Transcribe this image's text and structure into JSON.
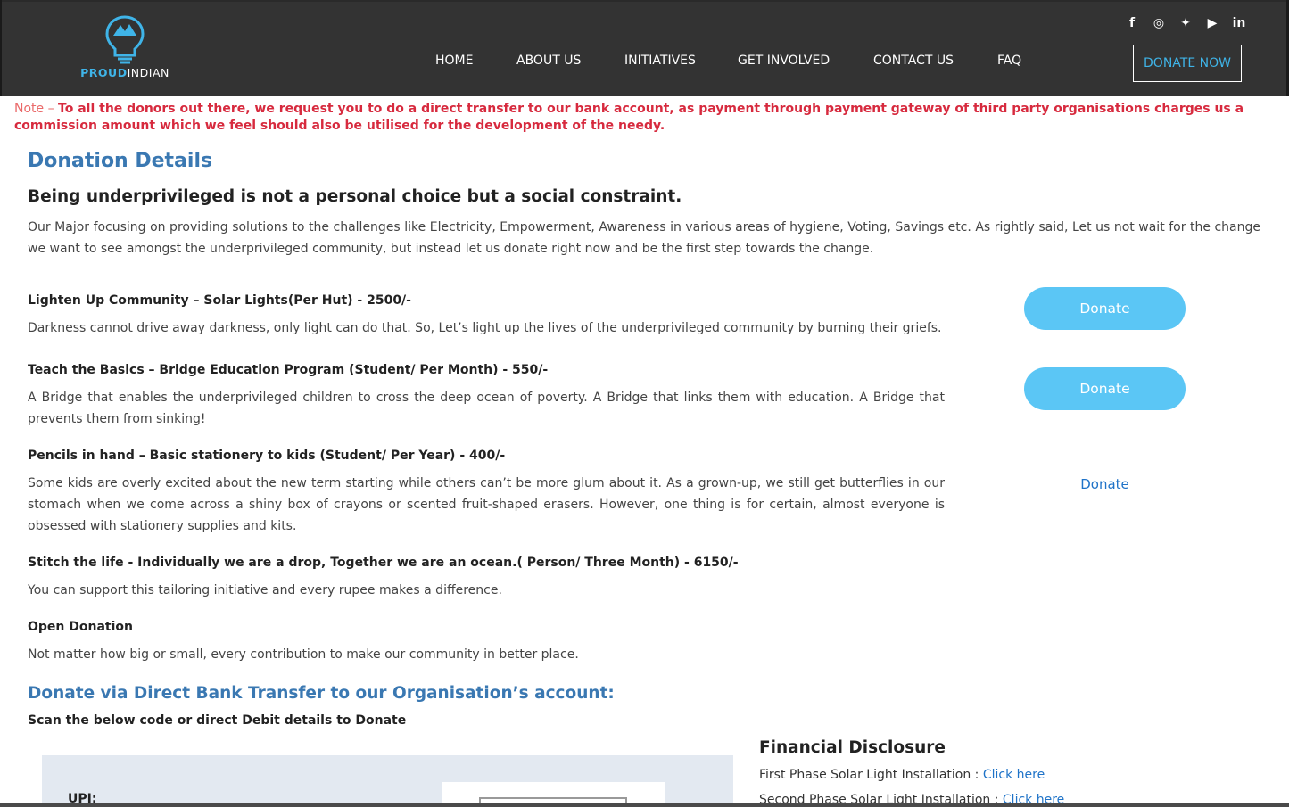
{
  "brand": {
    "name_part1": "PROUD",
    "name_part2": "INDIAN"
  },
  "social": [
    {
      "icon": "facebook-icon",
      "glyph": "f"
    },
    {
      "icon": "instagram-icon",
      "glyph": "◎"
    },
    {
      "icon": "twitter-icon",
      "glyph": "✦"
    },
    {
      "icon": "youtube-icon",
      "glyph": "▶"
    },
    {
      "icon": "linkedin-icon",
      "glyph": "in"
    }
  ],
  "nav": {
    "home": "HOME",
    "about": "ABOUT US",
    "initiatives": "INITIATIVES",
    "get_involved": "GET INVOLVED",
    "contact": "CONTACT US",
    "faq": "FAQ",
    "donate_now": "DONATE NOW"
  },
  "note": {
    "label": "Note – ",
    "text": "To all the donors out there, we request you to do a direct transfer to our bank account, as payment through payment gateway of third party organisations charges us a commission amount which we feel should also be utilised for the development of the needy."
  },
  "donation": {
    "heading": "Donation Details",
    "tagline": "Being underprivileged is not a personal choice but a social constraint.",
    "intro": "Our Major focusing on providing solutions to the challenges like Electricity, Empowerment, Awareness in various areas of hygiene, Voting, Savings etc. As rightly said, Let us not wait for the change we want to see amongst the underprivileged community, but instead let us donate right now and be the first step towards the change.",
    "items": [
      {
        "title": "Lighten Up Community – Solar Lights(Per Hut) - 2500/-",
        "desc": "Darkness cannot drive away darkness, only light can do that. So, Let’s light up the lives of the underprivileged community by burning their griefs.",
        "action": "Donate"
      },
      {
        "title": "Teach the Basics – Bridge Education Program (Student/ Per Month) - 550/-",
        "desc": "A Bridge that enables the underprivileged children to cross the deep ocean of poverty. A Bridge that links them with education. A Bridge that prevents them from sinking!",
        "action": "Donate"
      },
      {
        "title": "Pencils in hand – Basic stationery to kids (Student/ Per Year) - 400/-",
        "desc": "Some kids are overly excited about the new term starting while others can’t be more glum about it. As a grown-up, we still get butterflies in our stomach when we come across a shiny box of crayons or scented fruit-shaped erasers. However, one thing is for certain, almost everyone is obsessed with stationery supplies and kits.",
        "action": "Donate"
      },
      {
        "title": "Stitch the life - Individually we are a drop, Together we are an ocean.( Person/ Three Month) - 6150/-",
        "desc": "You can support this tailoring initiative and every rupee makes a difference."
      },
      {
        "title": "Open Donation",
        "desc": "Not matter how big or small, every contribution to make our community in better place."
      }
    ]
  },
  "bank": {
    "heading": "Donate via Direct Bank Transfer to our Organisation’s account:",
    "scan_text": "Scan the below code or direct Debit details to Donate",
    "upi_label": "UPI:"
  },
  "financial": {
    "heading": "Financial Disclosure",
    "rows": [
      {
        "label": "First Phase Solar Light Installation : ",
        "link": "Click here"
      },
      {
        "label": "Second Phase Solar Light Installation : ",
        "link": "Click here"
      }
    ]
  },
  "colors": {
    "header_bg": "#333333",
    "accent_blue": "#3fb4e8",
    "heading_blue": "#3a78b2",
    "note_red": "#d72a3e",
    "donate_button": "#5bc6f5",
    "link_blue": "#1f73c8"
  }
}
